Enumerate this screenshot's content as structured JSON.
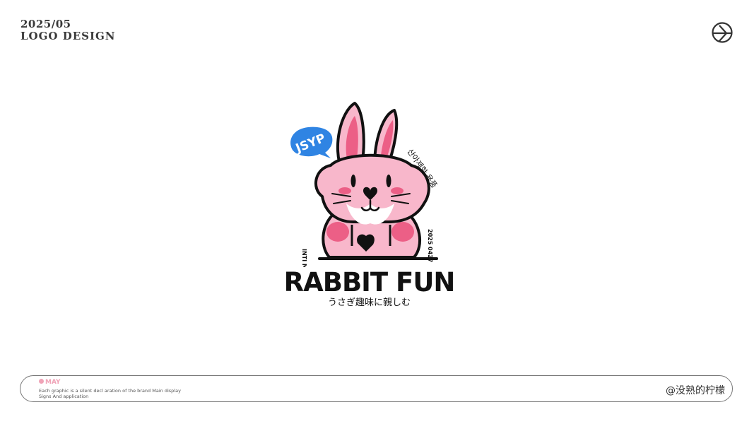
{
  "header": {
    "date": "2025/05",
    "title": "LOGO DESIGN"
  },
  "logo": {
    "bubble_text": "JSYP",
    "korean_text": "산아제한 용품",
    "left_vertical": "INTI MATE",
    "right_vertical": "2025 0427",
    "brand_name": "RABBIT FUN",
    "tagline": "うさぎ趣味に親しむ",
    "colors": {
      "pink": "#f8b7cb",
      "deep_pink": "#ec5f86",
      "bubble_blue": "#2f84e3",
      "ink": "#111111"
    }
  },
  "footer": {
    "month": "MAY",
    "desc_line1": "Each graphic is a silent decl aration of the brand Main display",
    "desc_line2": "Signs And application",
    "signature": "@没熟的柠檬"
  },
  "icons": {
    "corner": "circle-arrow-icon"
  }
}
